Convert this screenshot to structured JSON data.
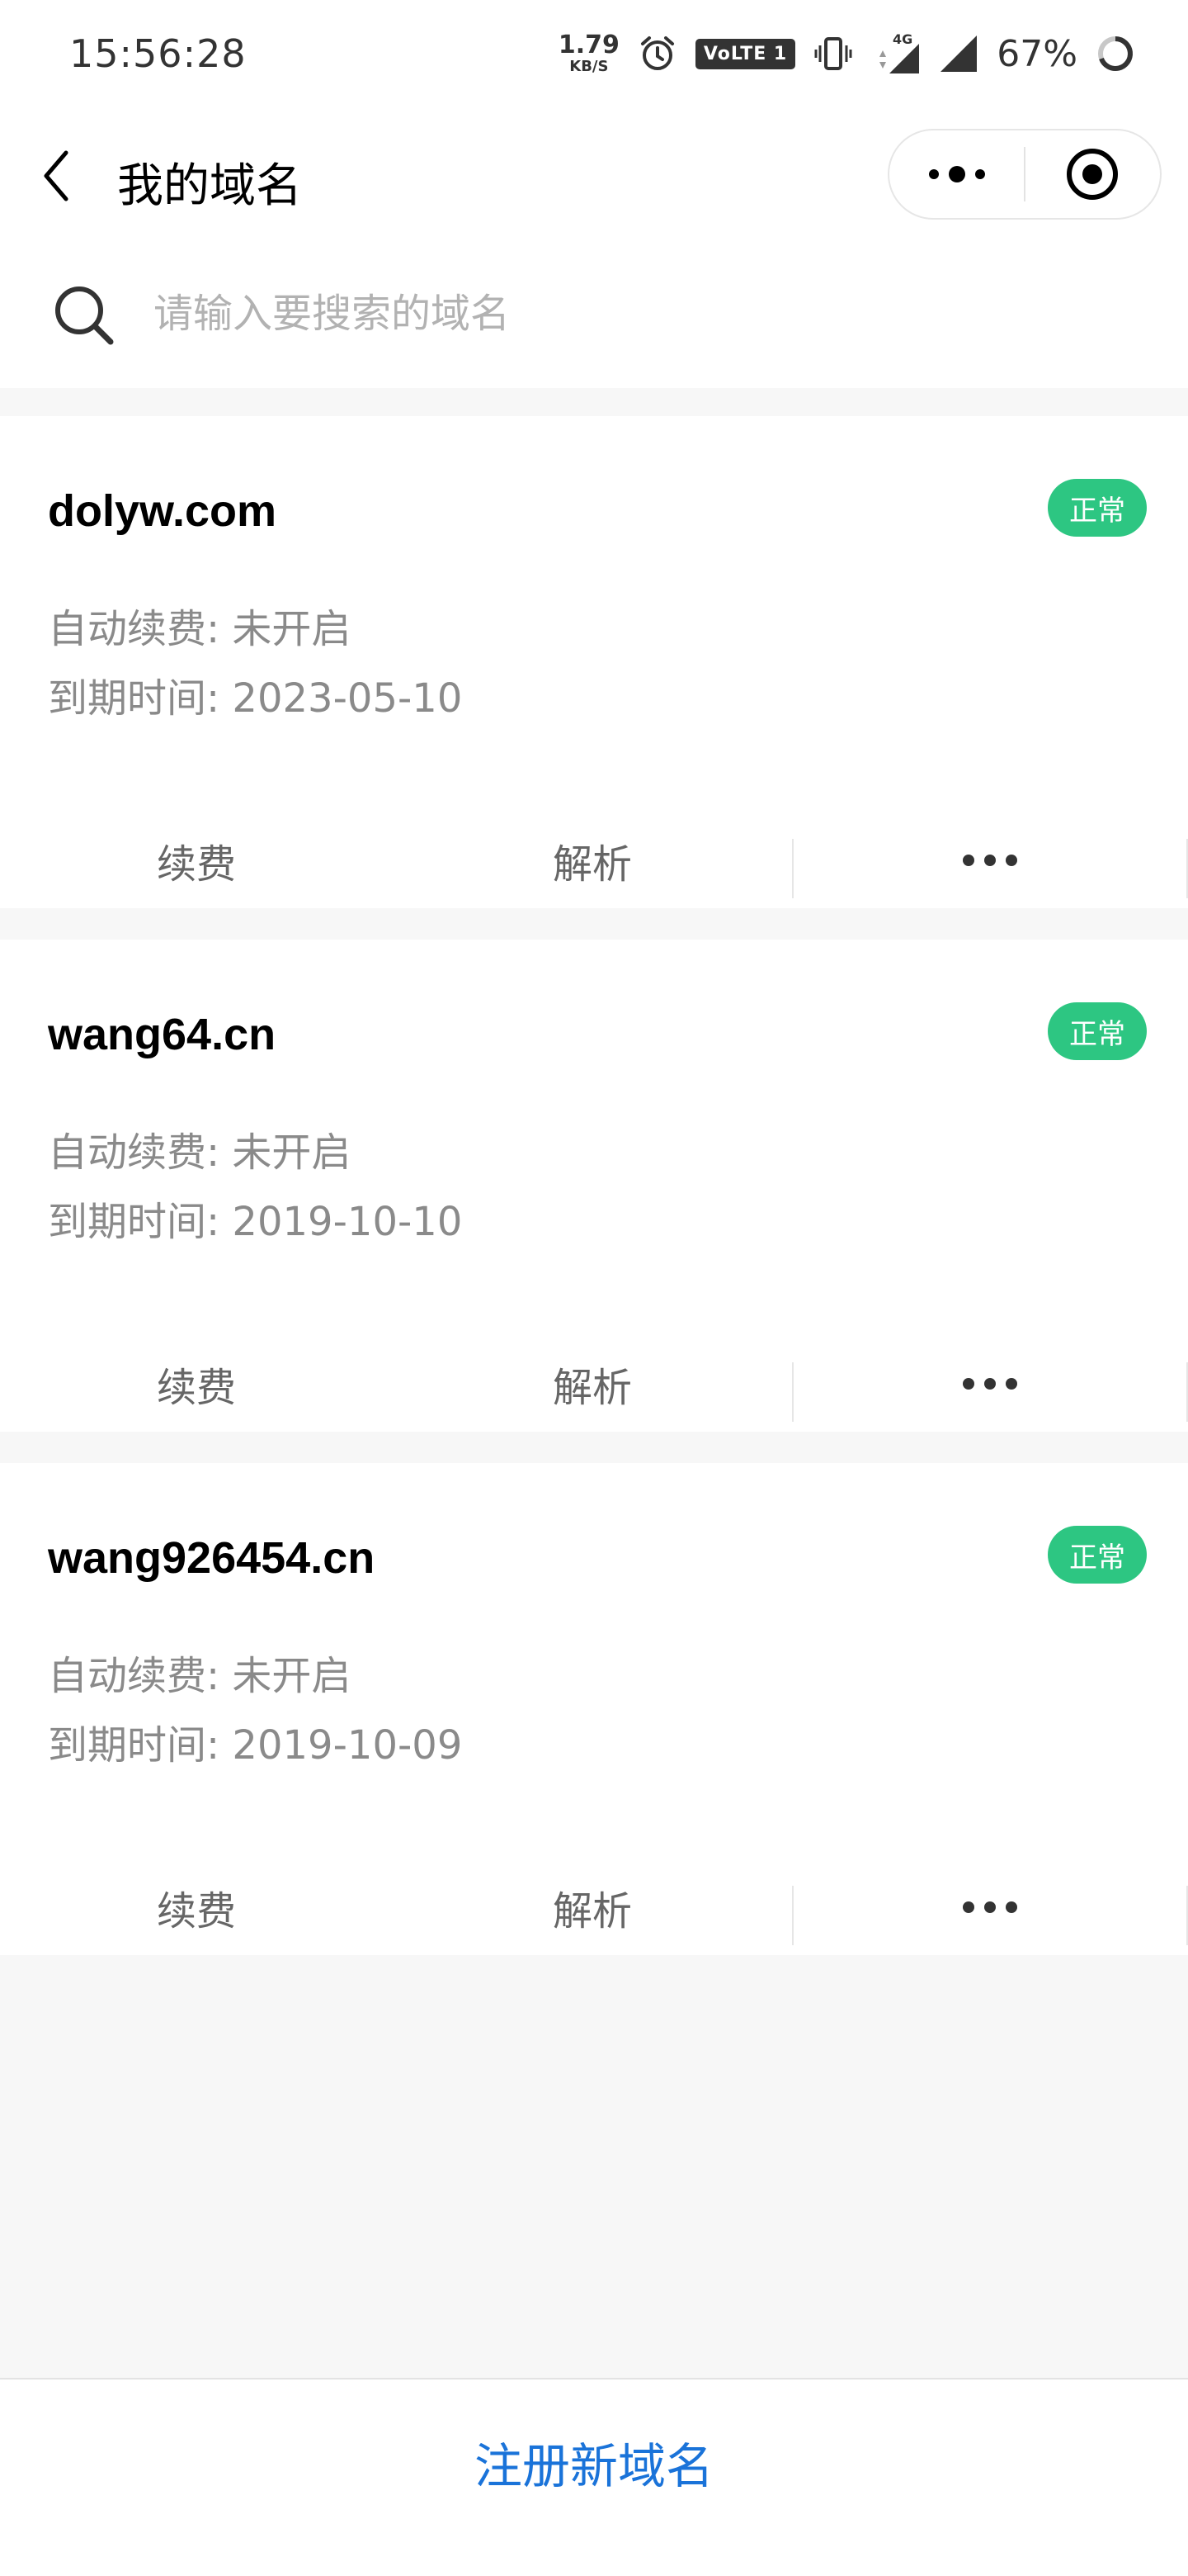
{
  "status_bar": {
    "time": "15:56:28",
    "net_speed": "1.79",
    "net_unit": "KB/S",
    "volte": "VoLTE 1",
    "network": "4G",
    "battery": "67%"
  },
  "nav": {
    "title": "我的域名"
  },
  "search": {
    "placeholder": "请输入要搜索的域名",
    "value": ""
  },
  "domains": [
    {
      "name": "dolyw.com",
      "status": "正常",
      "auto_renew": "自动续费: 未开启",
      "expire": "到期时间: 2023-05-10"
    },
    {
      "name": "wang64.cn",
      "status": "正常",
      "auto_renew": "自动续费: 未开启",
      "expire": "到期时间: 2019-10-10"
    },
    {
      "name": "wang926454.cn",
      "status": "正常",
      "auto_renew": "自动续费: 未开启",
      "expire": "到期时间: 2019-10-09"
    }
  ],
  "actions": {
    "renew": "续费",
    "dns": "解析"
  },
  "bottom": {
    "register_label": "注册新域名"
  },
  "colors": {
    "badge": "#2dc682",
    "link": "#1a73d9",
    "background": "#f7f7f7"
  }
}
